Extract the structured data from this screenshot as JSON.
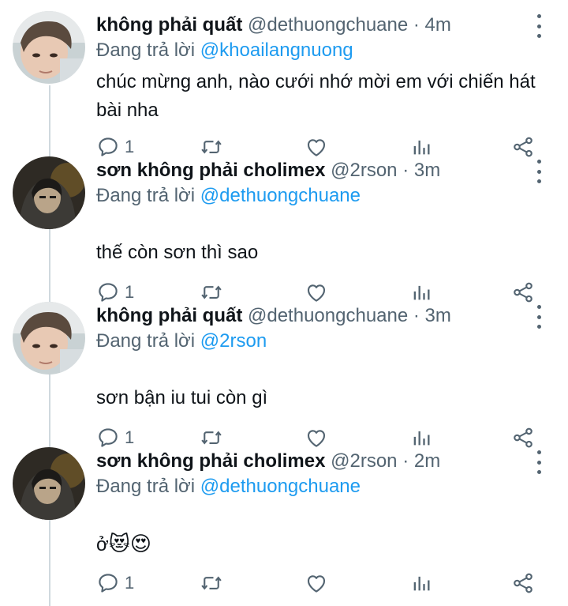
{
  "reply_prefix": "Đang trả lời",
  "tweets": [
    {
      "name": "không phải quất",
      "handle": "@dethuongchuane",
      "dot": "·",
      "time": "4m",
      "reply_to": "@khoailangnuong",
      "text": "chúc mừng anh, nào cưới nhớ mời em với chiến hát bài nha",
      "reply_count": "1",
      "avatar": "avatar-light"
    },
    {
      "name": "sơn không phải cholimex",
      "handle": "@2rson",
      "dot": "·",
      "time": "3m",
      "reply_to": "@dethuongchuane",
      "text": "thế còn sơn thì sao",
      "reply_count": "1",
      "avatar": "avatar-dark"
    },
    {
      "name": "không phải quất",
      "handle": "@dethuongchuane",
      "dot": "·",
      "time": "3m",
      "reply_to": "@2rson",
      "text": "sơn bận iu tui còn gì",
      "reply_count": "1",
      "avatar": "avatar-light"
    },
    {
      "name": "sơn không phải cholimex",
      "handle": "@2rson",
      "dot": "·",
      "time": "2m",
      "reply_to": "@dethuongchuane",
      "text": "ở",
      "emojis": [
        "😻",
        "😍"
      ],
      "reply_count": "1",
      "avatar": "avatar-dark"
    }
  ],
  "icons": {
    "reply": "speech-bubble-icon",
    "retweet": "retweet-icon",
    "like": "heart-icon",
    "analytics": "bar-chart-icon",
    "share": "share-icon",
    "more": "vertical-ellipsis-icon"
  },
  "colors": {
    "text": "#0f1419",
    "secondary": "#536471",
    "accent": "#1d9bf0",
    "thread_line": "#cfd9de"
  }
}
